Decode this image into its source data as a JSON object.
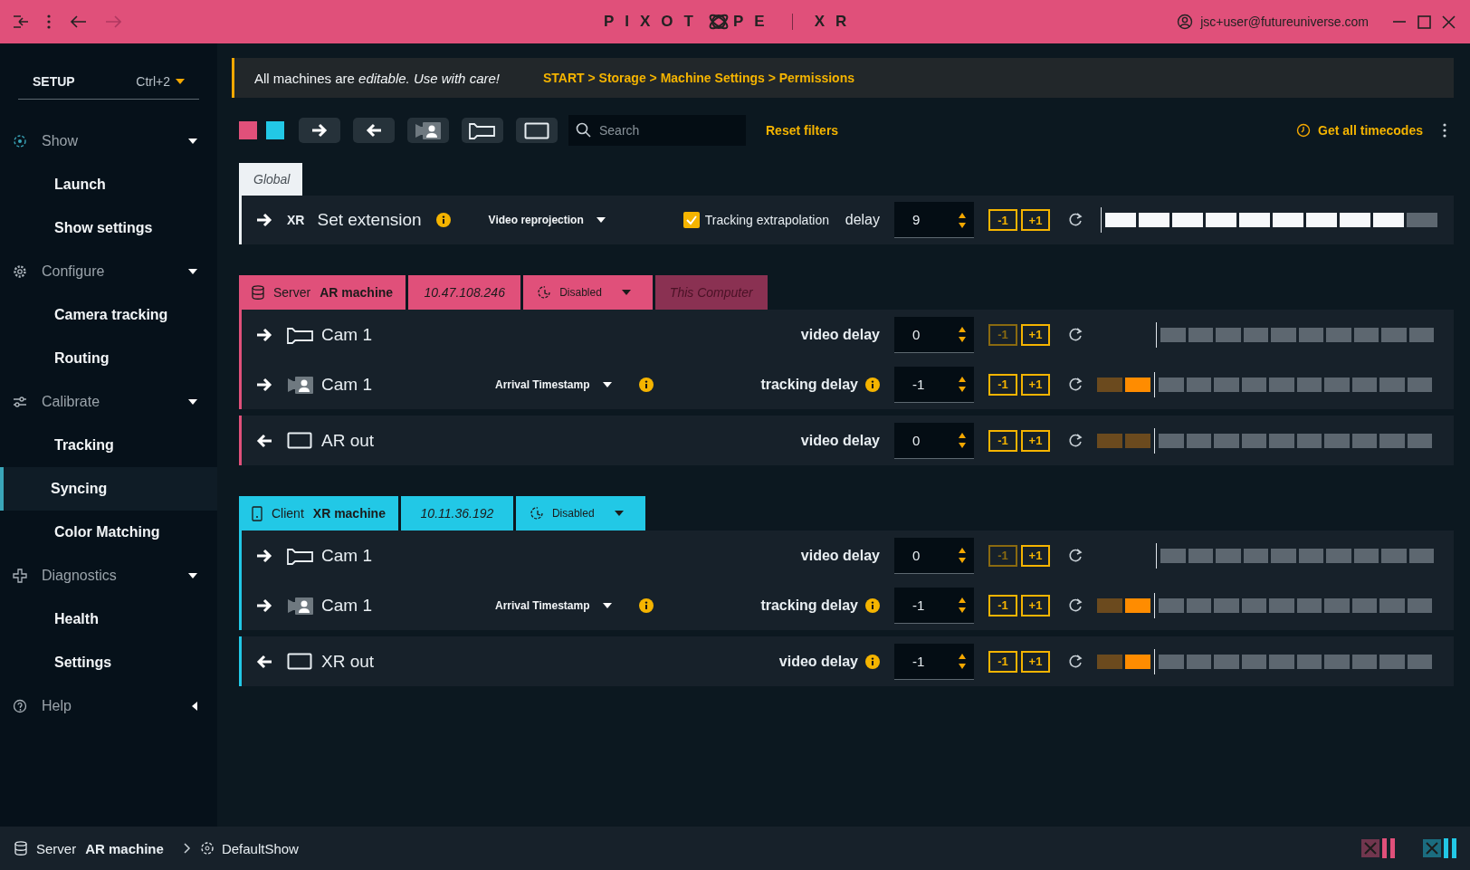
{
  "window": {
    "logo_left": "PIXOT",
    "logo_right": "PE",
    "product": "XR",
    "user": "jsc+user@futureuniverse.com"
  },
  "sidebar": {
    "mode": "SETUP",
    "shortcut": "Ctrl+2",
    "groups": [
      {
        "label": "Show",
        "expanded": true,
        "items": [
          {
            "label": "Launch",
            "selected": false
          },
          {
            "label": "Show settings",
            "selected": false
          }
        ]
      },
      {
        "label": "Configure",
        "expanded": true,
        "items": [
          {
            "label": "Camera tracking",
            "selected": false
          },
          {
            "label": "Routing",
            "selected": false
          }
        ]
      },
      {
        "label": "Calibrate",
        "expanded": true,
        "items": [
          {
            "label": "Tracking",
            "selected": false
          },
          {
            "label": "Syncing",
            "selected": true
          },
          {
            "label": "Color Matching",
            "selected": false
          }
        ]
      },
      {
        "label": "Diagnostics",
        "expanded": true,
        "items": [
          {
            "label": "Health",
            "selected": false
          },
          {
            "label": "Settings",
            "selected": false
          }
        ]
      },
      {
        "label": "Help",
        "expanded": false
      }
    ]
  },
  "banner": {
    "message": "All machines are *editable. Use with care!*",
    "breadcrumb": "START > Storage > Machine Settings > Permissions"
  },
  "toolbar": {
    "filters": [
      {
        "kind": "color",
        "color": "#e0507a"
      },
      {
        "kind": "color",
        "color": "#22c8e6"
      },
      {
        "kind": "input"
      },
      {
        "kind": "output"
      },
      {
        "kind": "tracker"
      },
      {
        "kind": "camera"
      },
      {
        "kind": "screen"
      }
    ],
    "search": {
      "placeholder": "Search"
    },
    "reset": "Reset filters",
    "timecodes": "Get all timecodes"
  },
  "global": {
    "tab": "Global",
    "row": {
      "badge": "XR",
      "label": "Set extension",
      "label_info": true,
      "mode": "Video reprojection",
      "option": {
        "label": "Tracking extrapolation",
        "checked": true
      },
      "delay_label": "delay",
      "value": "9",
      "minus": "-1",
      "plus": "+1",
      "minus_disabled": false,
      "level": 0.9
    }
  },
  "machines": [
    {
      "kind": "server",
      "color": "#e0507a",
      "role": "Server",
      "name": "AR machine",
      "ip": "10.47.108.246",
      "status": "Disabled",
      "tag": "This Computer",
      "groups": [
        {
          "rows": [
            {
              "kind": "camera-in",
              "label": "Cam 1",
              "delay_label": "video delay",
              "value": "0",
              "minus": "-1",
              "plus": "+1",
              "minus_disabled": true
            },
            {
              "kind": "tracker-in",
              "label": "Cam 1",
              "mode": "Arrival Timestamp",
              "mode_info": true,
              "delay_label": "tracking delay",
              "delay_info": true,
              "value": "-1",
              "minus": "-1",
              "plus": "+1",
              "minus_disabled": false,
              "pre": [
                {
                  "lit": false
                },
                {
                  "lit": true
                }
              ]
            }
          ]
        },
        {
          "rows": [
            {
              "kind": "screen-out",
              "label": "AR out",
              "delay_label": "video delay",
              "value": "0",
              "minus": "-1",
              "plus": "+1",
              "minus_disabled": false,
              "pre": [
                {
                  "lit": false
                },
                {
                  "lit": false
                }
              ]
            }
          ]
        }
      ]
    },
    {
      "kind": "client",
      "color": "#22c8e6",
      "role": "Client",
      "name": "XR machine",
      "ip": "10.11.36.192",
      "status": "Disabled",
      "groups": [
        {
          "rows": [
            {
              "kind": "camera-in",
              "label": "Cam 1",
              "delay_label": "video delay",
              "value": "0",
              "minus": "-1",
              "plus": "+1",
              "minus_disabled": true
            },
            {
              "kind": "tracker-in",
              "label": "Cam 1",
              "mode": "Arrival Timestamp",
              "mode_info": true,
              "delay_label": "tracking delay",
              "delay_info": true,
              "value": "-1",
              "minus": "-1",
              "plus": "+1",
              "minus_disabled": false,
              "pre": [
                {
                  "lit": false
                },
                {
                  "lit": true
                }
              ]
            }
          ]
        },
        {
          "rows": [
            {
              "kind": "screen-out",
              "label": "XR out",
              "delay_label": "video delay",
              "delay_info": true,
              "value": "-1",
              "minus": "-1",
              "plus": "+1",
              "minus_disabled": false,
              "pre": [
                {
                  "lit": false
                },
                {
                  "lit": true
                }
              ]
            }
          ]
        }
      ]
    }
  ],
  "status_bar": {
    "role": "Server",
    "name": "AR machine",
    "show": "DefaultShow",
    "indicators": [
      {
        "color": "#e0507a"
      },
      {
        "color": "#22c8e6"
      }
    ]
  }
}
